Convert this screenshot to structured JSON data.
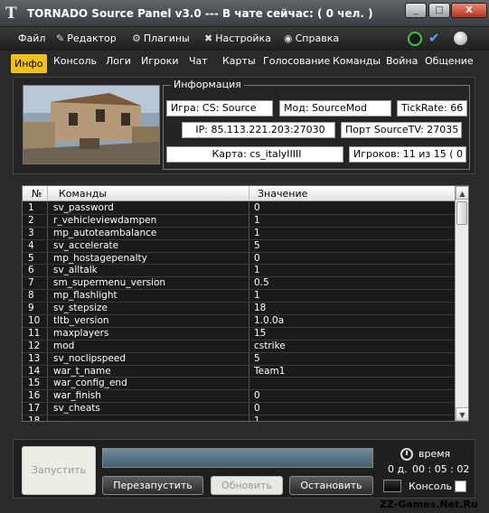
{
  "window": {
    "title": "TORNADO Source Panel v3.0 --- В чате сейчас: ( 0 чел. )",
    "buttons": {
      "minimize": "_",
      "maximize": "□",
      "close": "X"
    }
  },
  "menu": {
    "items": [
      {
        "label": "Файл",
        "icon": ""
      },
      {
        "label": "Редактор",
        "icon": "pencil-icon"
      },
      {
        "label": "Плагины",
        "icon": "plugin-icon"
      },
      {
        "label": "Настройка",
        "icon": "tools-icon"
      },
      {
        "label": "Справка",
        "icon": "help-icon"
      }
    ],
    "status_color": "#3cc83c",
    "check_color": "#5ea0ff"
  },
  "tabs": [
    "Инфо",
    "Консоль",
    "Логи",
    "Игроки",
    "Чат",
    "Карты",
    "Голосование",
    "Команды",
    "Война",
    "Общение"
  ],
  "info": {
    "legend": "Информация",
    "game": "Игра: CS: Source",
    "mod": "Мод: SourceMod",
    "tickrate": "TickRate: 66",
    "ip": "IP: 85.113.221.203:27030",
    "sourcetv": "Порт SourceTV:  27035",
    "map": "Карта: cs_italyIIIII",
    "players": "Игроков: 11 из 15 ( 0 ) I"
  },
  "grid": {
    "headers": {
      "num": "№",
      "command": "Команды",
      "value": "Значение"
    },
    "rows": [
      {
        "num": "1",
        "command": "sv_password",
        "value": "0"
      },
      {
        "num": "2",
        "command": "r_vehicleviewdampen",
        "value": "1"
      },
      {
        "num": "3",
        "command": "mp_autoteambalance",
        "value": "1"
      },
      {
        "num": "4",
        "command": "sv_accelerate",
        "value": "5"
      },
      {
        "num": "5",
        "command": "mp_hostagepenalty",
        "value": "0"
      },
      {
        "num": "6",
        "command": "sv_alltalk",
        "value": "1"
      },
      {
        "num": "7",
        "command": "sm_supermenu_version",
        "value": "0.5"
      },
      {
        "num": "8",
        "command": "mp_flashlight",
        "value": "1"
      },
      {
        "num": "9",
        "command": "sv_stepsize",
        "value": "18"
      },
      {
        "num": "10",
        "command": "tltb_version",
        "value": "1.0.0a"
      },
      {
        "num": "11",
        "command": "maxplayers",
        "value": "15"
      },
      {
        "num": "12",
        "command": "mod",
        "value": "cstrike"
      },
      {
        "num": "13",
        "command": "sv_noclipspeed",
        "value": "5"
      },
      {
        "num": "14",
        "command": "war_t_name",
        "value": "Team1"
      },
      {
        "num": "15",
        "command": "war_config_end",
        "value": ""
      },
      {
        "num": "16",
        "command": "war_finish",
        "value": "0"
      },
      {
        "num": "17",
        "command": "sv_cheats",
        "value": "0"
      },
      {
        "num": "18",
        "command": "",
        "value": "1"
      }
    ]
  },
  "controls": {
    "start": "Запустить",
    "restart": "Перезапустить",
    "refresh": "Обновить",
    "stop": "Остановить",
    "progress": 0,
    "time_label": "время",
    "days": "0 д.",
    "time": "00 : 05 : 02",
    "console": "Консоль"
  },
  "watermark": "ZZ-Games.Net.Ru"
}
